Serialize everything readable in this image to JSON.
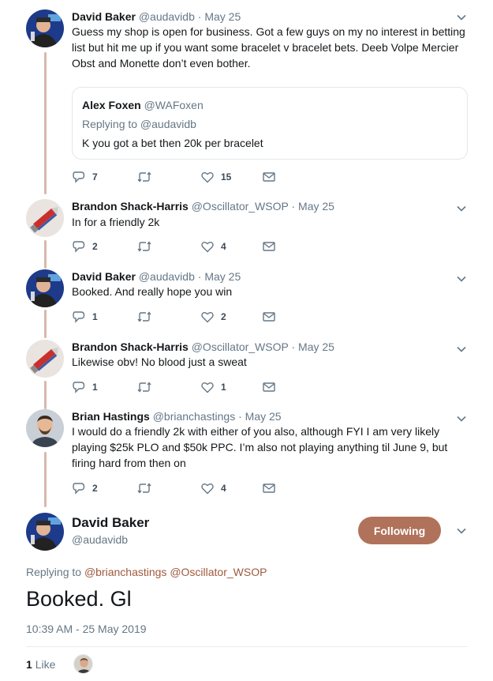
{
  "tweets": [
    {
      "name": "David Baker",
      "handle": "@audavidb",
      "dot": "·",
      "date": "May 25",
      "text": "Guess my shop is open for business. Got a few guys on my no interest in betting list but hit me up if you want some bracelet v bracelet bets. Deeb Volpe Mercier Obst and Monette don’t even bother.",
      "quote": {
        "name": "Alex Foxen",
        "handle": "@WAFoxen",
        "replying": "Replying to @audavidb",
        "text": "K you got a bet then 20k per bracelet"
      },
      "replies": "7",
      "retweets": "",
      "likes": "15"
    },
    {
      "name": "Brandon Shack-Harris",
      "handle": "@Oscillator_WSOP",
      "dot": "·",
      "date": "May 25",
      "text": "In for a friendly 2k",
      "replies": "2",
      "retweets": "",
      "likes": "4"
    },
    {
      "name": "David Baker",
      "handle": "@audavidb",
      "dot": "·",
      "date": "May 25",
      "text": "Booked. And really hope you win",
      "replies": "1",
      "retweets": "",
      "likes": "2"
    },
    {
      "name": "Brandon Shack-Harris",
      "handle": "@Oscillator_WSOP",
      "dot": "·",
      "date": "May 25",
      "text": "Likewise obv! No blood just a sweat",
      "replies": "1",
      "retweets": "",
      "likes": "1"
    },
    {
      "name": "Brian Hastings",
      "handle": "@brianchastings",
      "dot": "·",
      "date": "May 25",
      "text": "I would do a friendly 2k with either of you also, although FYI I am very likely playing $25k PLO and $50k PPC. I’m also not playing anything til June 9, but firing hard from then on",
      "replies": "2",
      "retweets": "",
      "likes": "4"
    }
  ],
  "focus": {
    "name": "David Baker",
    "handle": "@audavidb",
    "follow_label": "Following",
    "replying_prefix": "Replying to",
    "mentions": [
      "@brianchastings",
      "@Oscillator_WSOP"
    ],
    "text": "Booked. Gl",
    "timestamp": "10:39 AM - 25 May 2019",
    "like_count": "1",
    "like_label": "Like"
  },
  "colors": {
    "accent": "#b0725a",
    "mention": "#a0593d",
    "thread_line": "#d8b9a8",
    "muted": "#657786"
  },
  "icons": [
    "reply-icon",
    "retweet-icon",
    "heart-icon",
    "message-icon",
    "chevron-down-icon"
  ]
}
